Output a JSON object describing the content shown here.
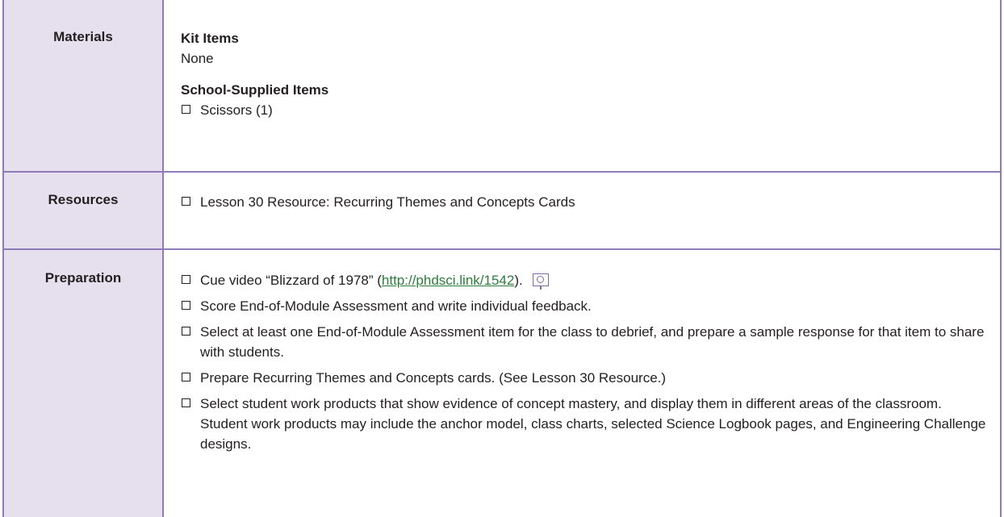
{
  "table": {
    "rows": [
      {
        "label": "Materials",
        "sections": [
          {
            "heading": "Kit Items",
            "text": "None"
          },
          {
            "heading": "School-Supplied Items",
            "items": [
              "Scissors (1)"
            ]
          }
        ]
      },
      {
        "label": "Resources",
        "items": [
          "Lesson 30 Resource: Recurring Themes and Concepts Cards"
        ]
      },
      {
        "label": "Preparation",
        "video_item": {
          "prefix": "Cue video “Blizzard of 1978” (",
          "link_text": "http://phdsci.link/1542",
          "suffix": ").",
          "icon": "media-clip-icon"
        },
        "items": [
          "Score End-of-Module Assessment and write individual feedback.",
          "Select at least one End-of-Module Assessment item for the class to debrief, and prepare a sample response for that item to share with students.",
          "Prepare Recurring Themes and Concepts cards. (See Lesson 30 Resource.)",
          "Select student work products that show evidence of concept mastery, and display them in different areas of the classroom. Student work products may include the anchor model, class charts, selected Science Logbook pages, and Engineering Challenge designs."
        ]
      }
    ]
  },
  "colors": {
    "border": "#8f7bb7",
    "label_bg": "#e6e0ee",
    "link": "#2c7d3b",
    "text": "#231f20"
  }
}
